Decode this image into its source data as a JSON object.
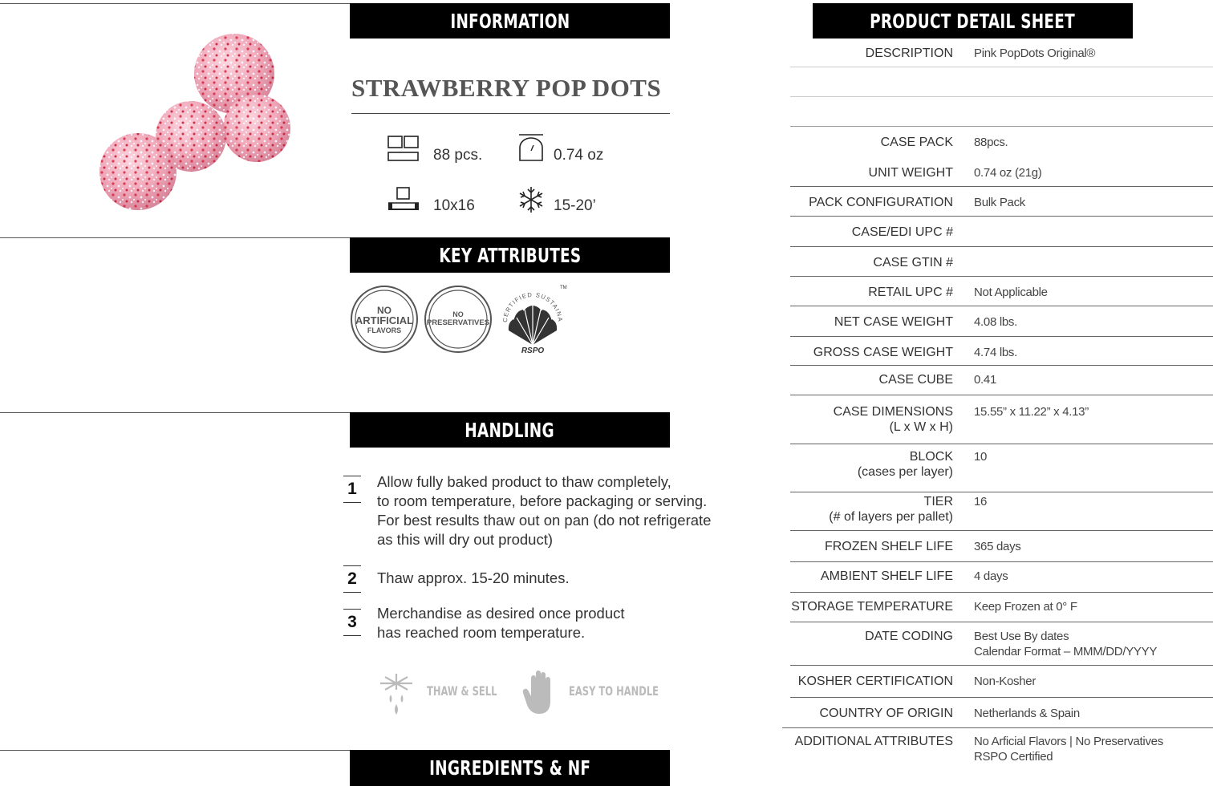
{
  "sections": {
    "information": "INFORMATION",
    "key_attributes": "KEY ATTRIBUTES",
    "handling": "HANDLING",
    "ingredients": "INGREDIENTS & NF",
    "detail_sheet": "PRODUCT DETAIL SHEET"
  },
  "product": {
    "title": "STRAWBERRY POP DOTS",
    "specs": {
      "pieces": "88 pcs.",
      "weight": "0.74 oz",
      "pallet": "10x16",
      "thaw": "15-20’"
    }
  },
  "badges": {
    "no_artificial": [
      "NO",
      "ARTIFICIAL",
      "FLAVORS"
    ],
    "no_preservatives": [
      "NO",
      "PRESERVATIVES"
    ],
    "rspo_ring": "CERTIFIED SUSTAINABLE PALM OIL",
    "rspo_mark": "RSPO",
    "rspo_tm": "TM"
  },
  "handling": {
    "steps": [
      {
        "num": "1",
        "lines": [
          "Allow fully baked product to thaw completely,",
          "to room temperature, before packaging or serving.",
          "For best results thaw out on pan (do not refrigerate",
          "as this will dry out product)"
        ]
      },
      {
        "num": "2",
        "lines": [
          "Thaw approx. 15-20 minutes."
        ]
      },
      {
        "num": "3",
        "lines": [
          "Merchandise as desired once product",
          "has reached room temperature."
        ]
      }
    ],
    "hints": [
      "THAW & SELL",
      "EASY TO HANDLE"
    ]
  },
  "detail": [
    {
      "label": [
        "DESCRIPTION"
      ],
      "value": [
        "Pink PopDots Original®"
      ]
    },
    {
      "label": [
        "CASE PACK"
      ],
      "value": [
        "88pcs."
      ]
    },
    {
      "label": [
        "UNIT WEIGHT"
      ],
      "value": [
        "0.74 oz (21g)"
      ]
    },
    {
      "label": [
        "PACK CONFIGURATION"
      ],
      "value": [
        "Bulk Pack"
      ]
    },
    {
      "label": [
        "CASE/EDI UPC #"
      ],
      "value": [
        ""
      ]
    },
    {
      "label": [
        "CASE GTIN #"
      ],
      "value": [
        ""
      ]
    },
    {
      "label": [
        "RETAIL UPC #"
      ],
      "value": [
        "Not Applicable"
      ]
    },
    {
      "label": [
        "NET CASE WEIGHT"
      ],
      "value": [
        "4.08 lbs."
      ]
    },
    {
      "label": [
        "GROSS CASE WEIGHT"
      ],
      "value": [
        "4.74 lbs."
      ]
    },
    {
      "label": [
        "CASE CUBE"
      ],
      "value": [
        "0.41"
      ]
    },
    {
      "label": [
        "CASE DIMENSIONS",
        "(L x W x H)"
      ],
      "value": [
        "15.55” x 11.22” x 4.13”"
      ]
    },
    {
      "label": [
        "BLOCK",
        "(cases per layer)"
      ],
      "value": [
        "10"
      ]
    },
    {
      "label": [
        "TIER",
        "(# of layers per pallet)"
      ],
      "value": [
        "16"
      ]
    },
    {
      "label": [
        "FROZEN SHELF LIFE"
      ],
      "value": [
        "365 days"
      ]
    },
    {
      "label": [
        "AMBIENT SHELF LIFE"
      ],
      "value": [
        "4 days"
      ]
    },
    {
      "label": [
        "STORAGE TEMPERATURE"
      ],
      "value": [
        "Keep Frozen at 0° F"
      ]
    },
    {
      "label": [
        "DATE CODING"
      ],
      "value": [
        "Best Use By dates",
        "Calendar Format – MMM/DD/YYYY"
      ]
    },
    {
      "label": [
        "KOSHER CERTIFICATION"
      ],
      "value": [
        "Non-Kosher"
      ]
    },
    {
      "label": [
        "COUNTRY OF ORIGIN"
      ],
      "value": [
        "Netherlands & Spain"
      ]
    },
    {
      "label": [
        "ADDITIONAL ATTRIBUTES"
      ],
      "value": [
        "No Arficial Flavors | No Preservatives",
        "RSPO Certified"
      ]
    }
  ]
}
